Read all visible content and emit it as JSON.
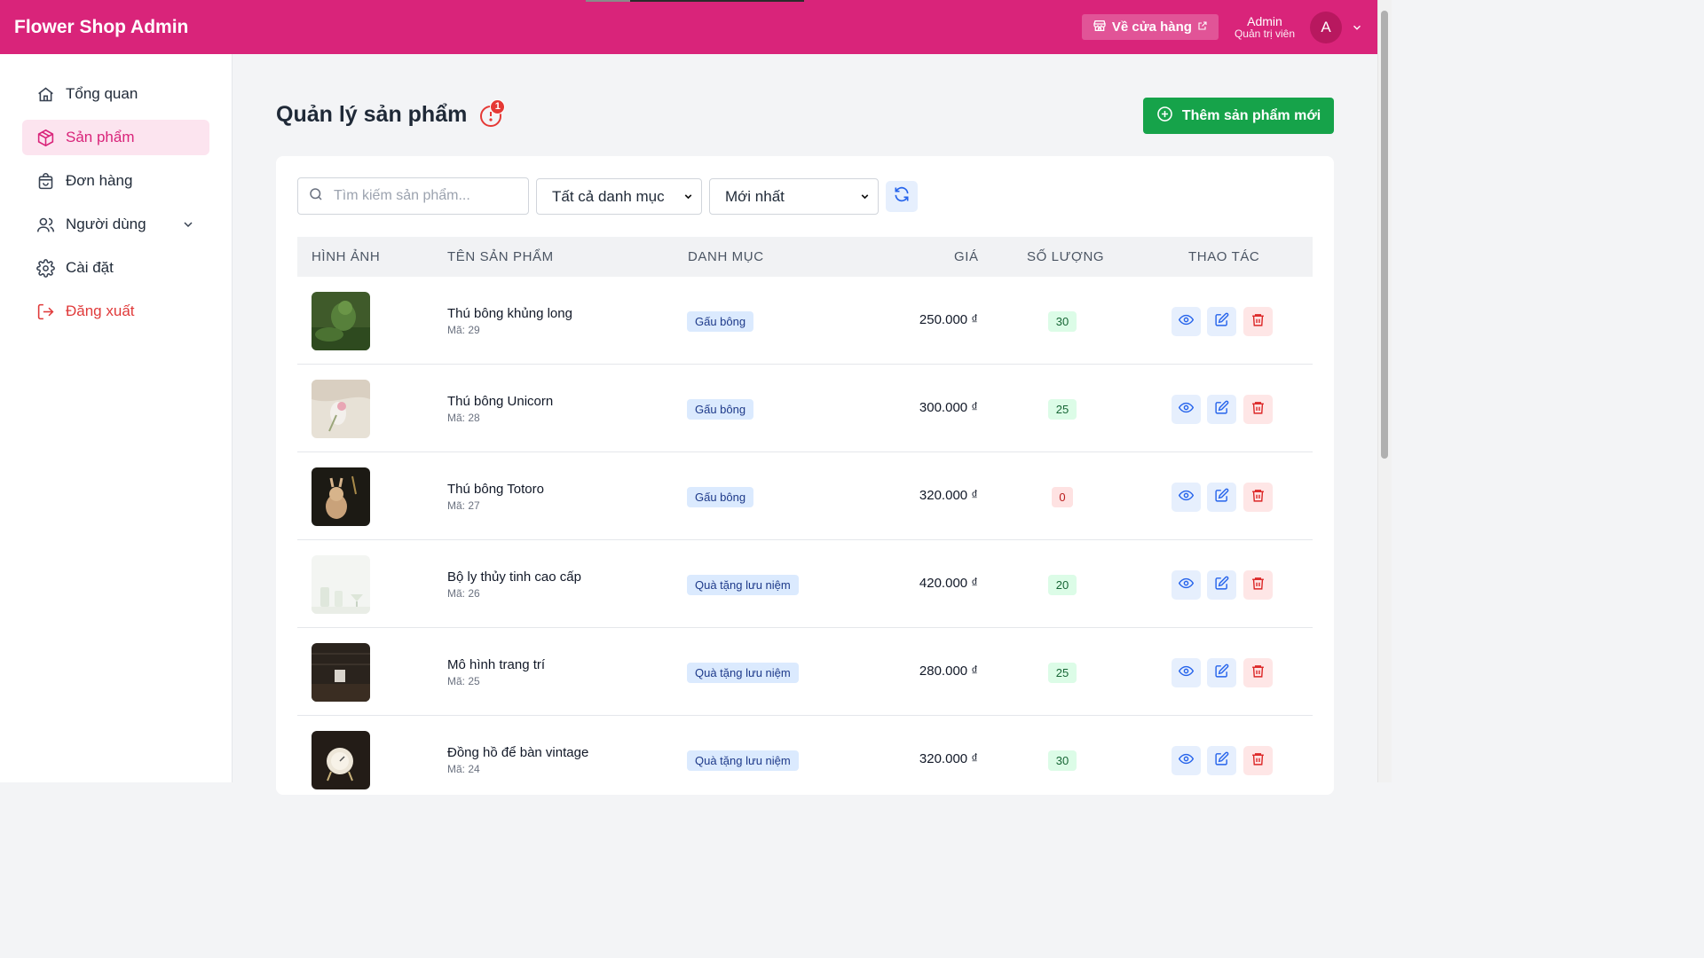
{
  "app": {
    "brand": "Flower Shop Admin"
  },
  "header": {
    "store_button": "Về cửa hàng",
    "user_name": "Admin",
    "user_role": "Quản trị viên",
    "avatar_initial": "A"
  },
  "sidebar": {
    "items": [
      {
        "label": "Tổng quan",
        "icon": "home-icon"
      },
      {
        "label": "Sản phẩm",
        "icon": "box-icon",
        "active": true
      },
      {
        "label": "Đơn hàng",
        "icon": "shopping-bag-icon"
      },
      {
        "label": "Người dùng",
        "icon": "users-icon",
        "expandable": true
      },
      {
        "label": "Cài đặt",
        "icon": "gear-icon"
      },
      {
        "label": "Đăng xuất",
        "icon": "logout-icon"
      }
    ]
  },
  "page": {
    "title": "Quản lý sản phẩm",
    "help_badge": "1",
    "add_button": "Thêm sản phẩm mới"
  },
  "filters": {
    "search_placeholder": "Tìm kiếm sản phẩm...",
    "category_selected": "Tất cả danh mục",
    "sort_selected": "Mới nhất"
  },
  "table": {
    "columns": [
      "HÌNH ẢNH",
      "TÊN SẢN PHẨM",
      "DANH MỤC",
      "GIÁ",
      "SỐ LƯỢNG",
      "THAO TÁC"
    ],
    "rows": [
      {
        "name": "Thú bông khủng long",
        "code": "Mã: 29",
        "category": "Gấu bông",
        "price": "250.000 ₫",
        "qty": "30"
      },
      {
        "name": "Thú bông Unicorn",
        "code": "Mã: 28",
        "category": "Gấu bông",
        "price": "300.000 ₫",
        "qty": "25"
      },
      {
        "name": "Thú bông Totoro",
        "code": "Mã: 27",
        "category": "Gấu bông",
        "price": "320.000 ₫",
        "qty": "0"
      },
      {
        "name": "Bộ ly thủy tinh cao cấp",
        "code": "Mã: 26",
        "category": "Quà tặng lưu niệm",
        "price": "420.000 ₫",
        "qty": "20"
      },
      {
        "name": "Mô hình trang trí",
        "code": "Mã: 25",
        "category": "Quà tặng lưu niệm",
        "price": "280.000 ₫",
        "qty": "25"
      },
      {
        "name": "Đồng hồ để bàn vintage",
        "code": "Mã: 24",
        "category": "Quà tặng lưu niệm",
        "price": "320.000 ₫",
        "qty": "30"
      }
    ]
  },
  "colors": {
    "brand": "#d9247a",
    "primary_action": "#16a34a",
    "link_blue": "#2563eb",
    "danger": "#e03a3a"
  }
}
